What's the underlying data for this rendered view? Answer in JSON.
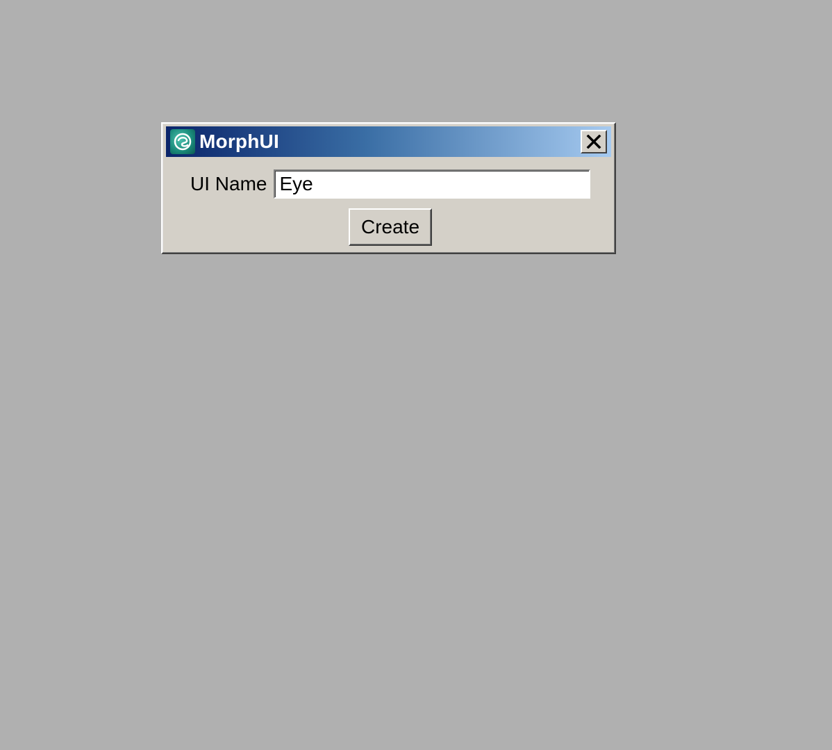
{
  "window": {
    "title": "MorphUI",
    "icon": "app-swirl-icon",
    "close_icon": "close-icon"
  },
  "form": {
    "name_label": "UI Name",
    "name_value": "Eye",
    "create_label": "Create"
  },
  "colors": {
    "desktop": "#b0b0b0",
    "window_bg": "#d4d0c8",
    "titlebar_start": "#0a246a",
    "titlebar_end": "#a6caf0"
  }
}
